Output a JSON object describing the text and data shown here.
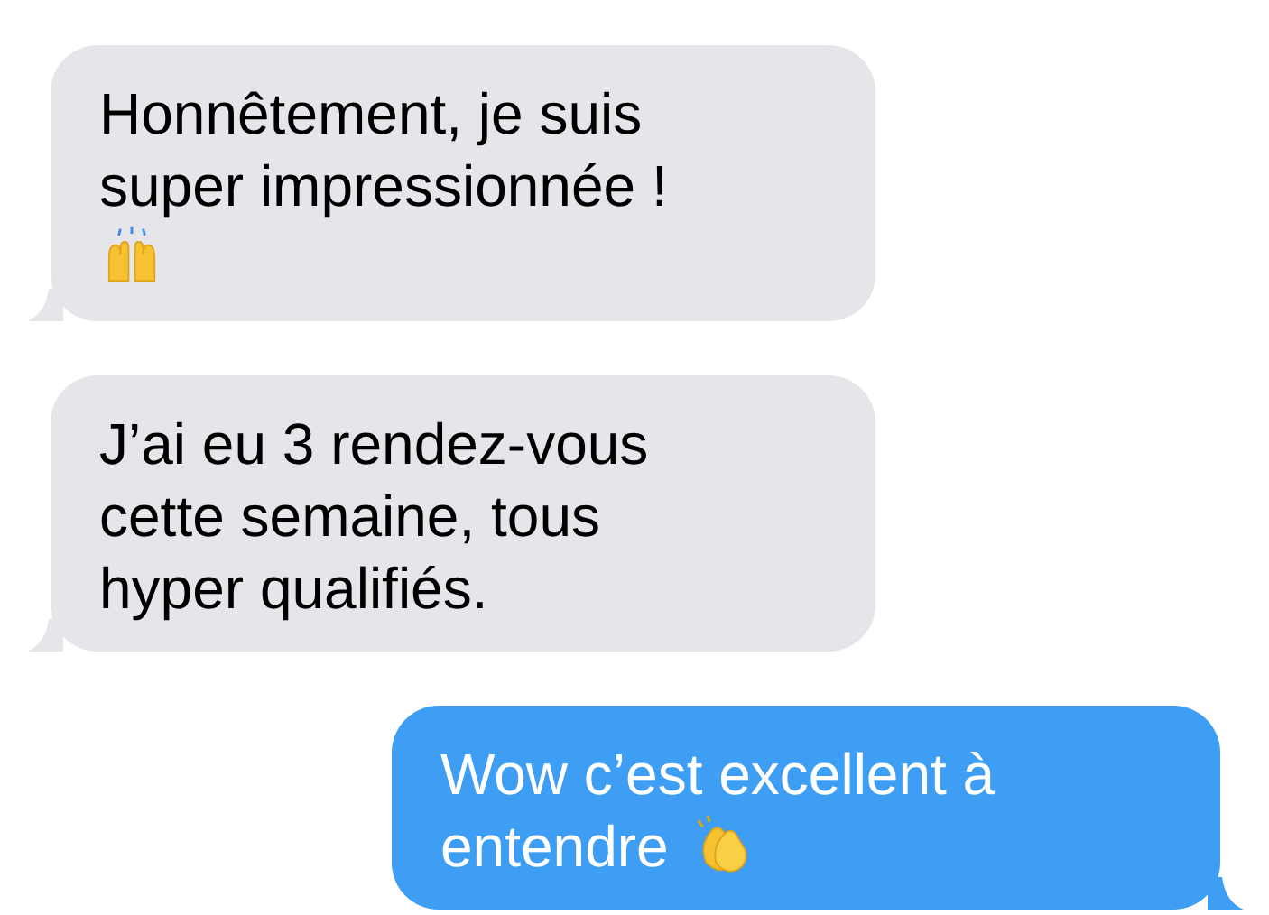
{
  "messages": [
    {
      "kind": "incoming",
      "lines": [
        {
          "kind": "text",
          "text": "Honnêtement, je suis"
        },
        {
          "kind": "text",
          "text": "super impressionnée !"
        },
        {
          "kind": "raised_hands"
        }
      ]
    },
    {
      "kind": "incoming",
      "lines": [
        {
          "kind": "text",
          "text": "J’ai eu 3 rendez-vous"
        },
        {
          "kind": "text",
          "text": "cette semaine, tous"
        },
        {
          "kind": "text",
          "text": "hyper qualifiés."
        }
      ]
    },
    {
      "kind": "outgoing",
      "lines": [
        {
          "kind": "text",
          "text": "Wow c’est excellent à"
        },
        {
          "kind": "clapping_hands",
          "text": "entendre"
        }
      ]
    }
  ]
}
